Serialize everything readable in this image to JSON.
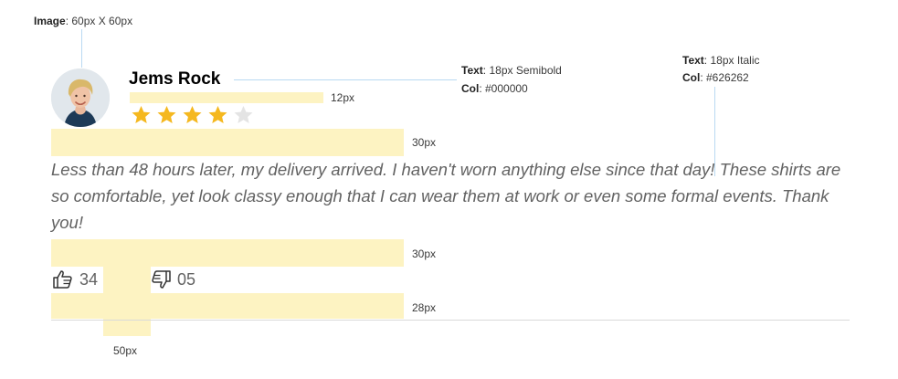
{
  "annotations": {
    "image": {
      "label": "Image",
      "value": ": 60px X 60px"
    },
    "name_text": {
      "label": "Text",
      "value": ": 18px Semibold"
    },
    "name_col": {
      "label": "Col",
      "value": ": #000000"
    },
    "review_text": {
      "label": "Text",
      "value": ": 18px Italic"
    },
    "review_col": {
      "label": "Col",
      "value": ": #626262"
    },
    "gap_12": "12px",
    "gap_30a": "30px",
    "gap_30b": "30px",
    "gap_28": "28px",
    "gap_50": "50px"
  },
  "review": {
    "author": "Jems Rock",
    "rating": 4,
    "rating_max": 5,
    "text": "Less than 48 hours later, my delivery arrived. I haven't worn anything else since that day! These shirts are so comfortable, yet look classy enough that I can wear them at work or even some formal events. Thank you!",
    "likes": "34",
    "dislikes": "05"
  },
  "colors": {
    "star_filled": "#f5b81f",
    "star_empty": "#e4e4e4",
    "spacer": "#fdf3c2",
    "review_text": "#626262",
    "author_text": "#000000"
  },
  "icons": {
    "like": "thumbs-up-icon",
    "dislike": "thumbs-down-icon",
    "star": "star-icon"
  }
}
